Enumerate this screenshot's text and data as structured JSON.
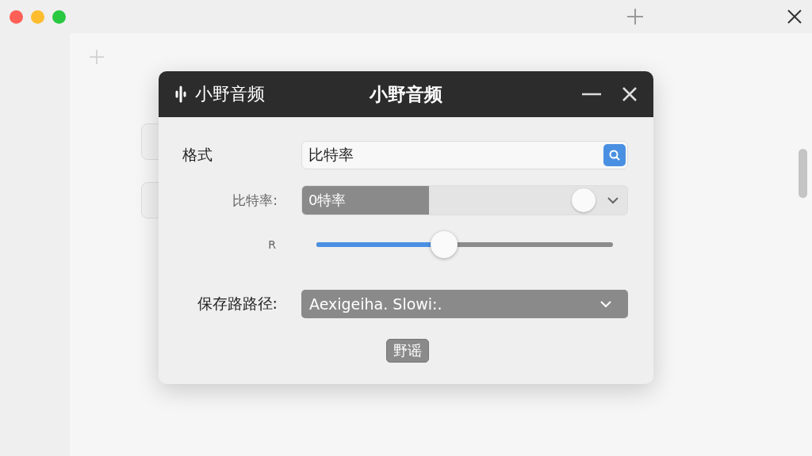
{
  "dialog": {
    "app_name": "小野音频",
    "title": "小野音频"
  },
  "rows": [
    {
      "kind": "field",
      "label": "格式",
      "value": "比特率"
    },
    {
      "kind": "bitrate",
      "label": "比特率:",
      "value": "0特率",
      "level": 0.39
    },
    {
      "kind": "slider",
      "label": "R",
      "level": 0.43
    },
    {
      "kind": "path",
      "label": "保存路路径:",
      "value": "Aexigeiha. Slowi:."
    }
  ],
  "button": "野谣"
}
